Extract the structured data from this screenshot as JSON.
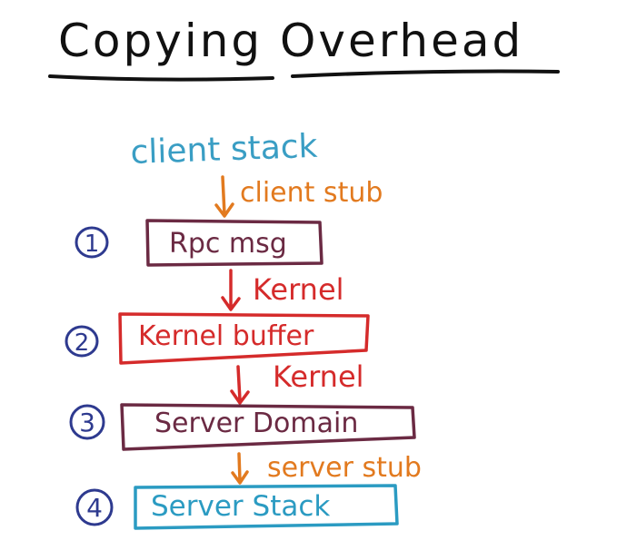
{
  "title": "Copying Overhead",
  "client_stack_label": "client stack",
  "steps": [
    {
      "number": "1",
      "box_label": "Rpc msg",
      "arrow_label": "client stub"
    },
    {
      "number": "2",
      "box_label": "Kernel buffer",
      "arrow_label": "Kernel"
    },
    {
      "number": "3",
      "box_label": "Server Domain",
      "arrow_label": "Kernel"
    },
    {
      "number": "4",
      "box_label": "Server Stack",
      "arrow_label": "server stub"
    }
  ],
  "colors": {
    "title_ink": "#111111",
    "client_stack": "#3a9ec4",
    "stub_label": "#e27a1f",
    "kernel_label": "#d52b2b",
    "rpc_box": "#6b2a43",
    "kernel_box": "#d52b2b",
    "server_domain_box": "#6b2a43",
    "server_stack_box": "#2b9bc2",
    "step_number": "#2e3a8f"
  }
}
